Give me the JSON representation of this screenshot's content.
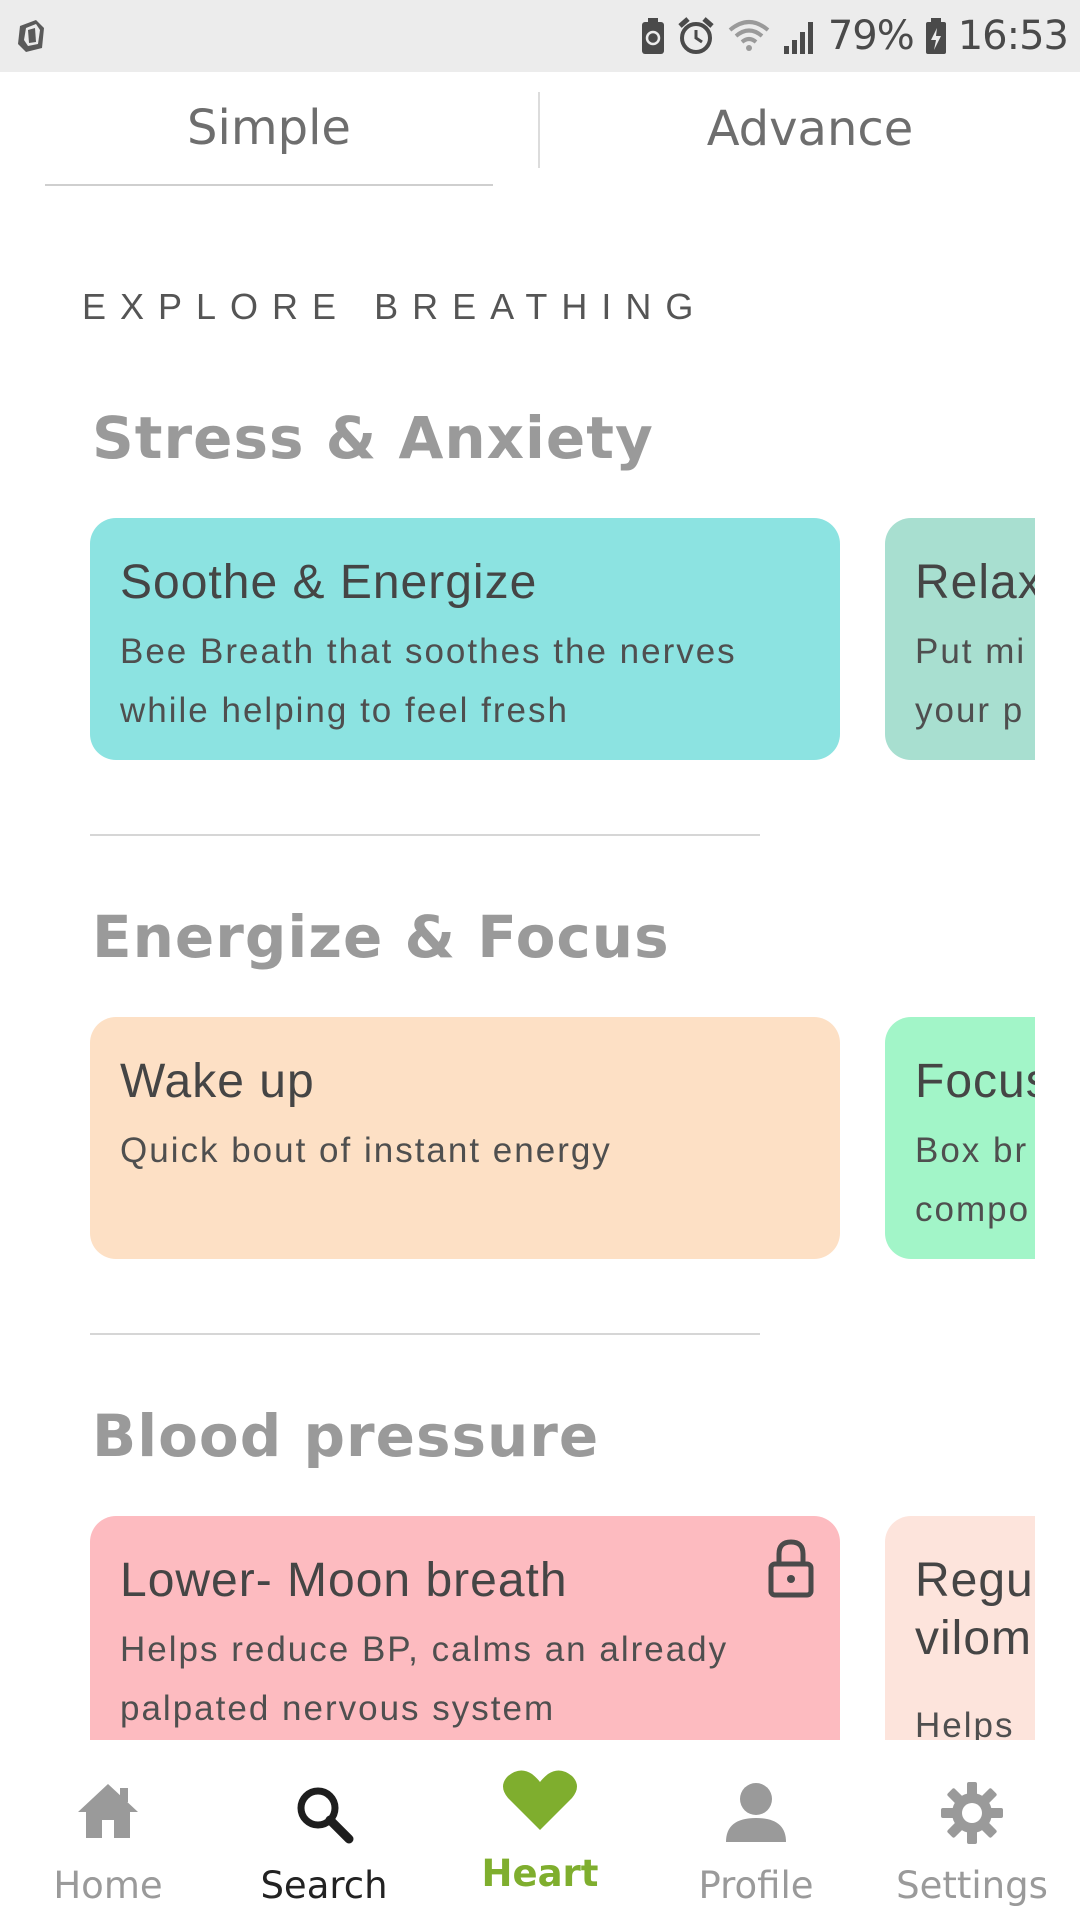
{
  "status_bar": {
    "battery_percent": "79%",
    "time": "16:53"
  },
  "tabs": [
    {
      "label": "Simple",
      "selected": true
    },
    {
      "label": "Advance",
      "selected": false
    }
  ],
  "explore_label": "EXPLORE BREATHING",
  "sections": [
    {
      "title": "Stress & Anxiety",
      "cards": [
        {
          "title": "Soothe & Energize",
          "description": "Bee Breath that soothes the nerves while helping to feel fresh",
          "color": "#8ce3e1",
          "locked": false
        },
        {
          "title": "Relax",
          "description": "Put mi your p",
          "color": "#a8dfd0",
          "locked": false
        }
      ]
    },
    {
      "title": "Energize & Focus",
      "cards": [
        {
          "title": "Wake up",
          "description": "Quick bout of instant energy",
          "color": "#fde0c5",
          "locked": false
        },
        {
          "title": "Focus",
          "description": "Box br compo",
          "color": "#a2f5c8",
          "locked": false
        }
      ]
    },
    {
      "title": "Blood pressure",
      "cards": [
        {
          "title": "Lower- Moon breath",
          "description": "Helps reduce BP, calms an already palpated nervous system",
          "color": "#fdbbc0",
          "locked": true
        },
        {
          "title": "Regu vilom",
          "description": "Helps",
          "color": "#fde4dc",
          "locked": false
        }
      ]
    }
  ],
  "bottom_nav": [
    {
      "label": "Home",
      "icon": "home-icon",
      "color": "#9a9a9a"
    },
    {
      "label": "Search",
      "icon": "search-icon",
      "color": "#222222"
    },
    {
      "label": "Heart",
      "icon": "heart-icon",
      "color": "#7fae2e"
    },
    {
      "label": "Profile",
      "icon": "profile-icon",
      "color": "#9a9a9a"
    },
    {
      "label": "Settings",
      "icon": "settings-icon",
      "color": "#9a9a9a"
    }
  ],
  "colors": {
    "accent_green": "#7fae2e",
    "status_bar_bg": "#ececec"
  }
}
